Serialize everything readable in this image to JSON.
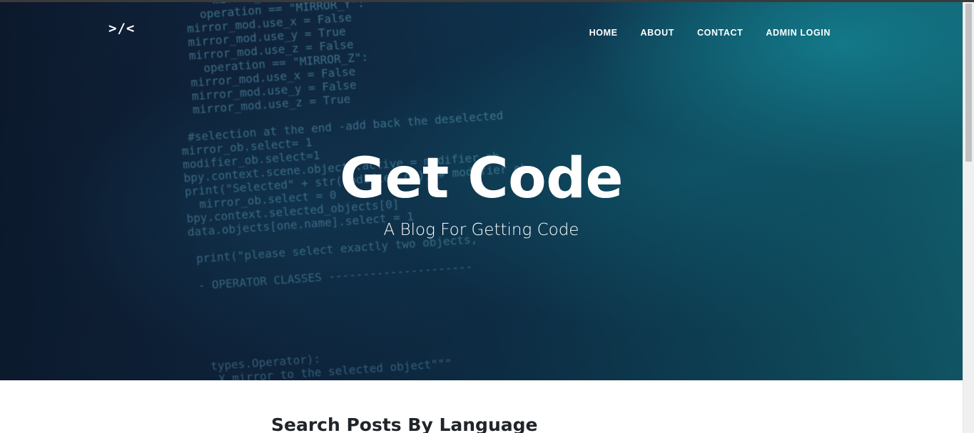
{
  "brand": {
    "logo_text": ">/<"
  },
  "nav": {
    "items": [
      {
        "label": "HOME"
      },
      {
        "label": "ABOUT"
      },
      {
        "label": "CONTACT"
      },
      {
        "label": "ADMIN LOGIN"
      }
    ]
  },
  "hero": {
    "title": "Get Code",
    "subtitle": "A Blog For Getting Code",
    "code_lines": [
      "       mirror_mod.use_z = False",
      "     operation == \"MIRROR_Y\":",
      "   mirror_mod.use_x = False",
      "   mirror_mod.use_y = True",
      "   mirror_mod.use_z = False",
      "     operation == \"MIRROR_Z\":",
      "   mirror_mod.use_x = False",
      "   mirror_mod.use_y = False",
      "   mirror_mod.use_z = True",
      "",
      "  #selection at the end -add back the deselected",
      " mirror_ob.select= 1",
      " modifier_ob.select=1",
      " bpy.context.scene.objects.active = modifier_ob",
      " print(\"Selected\" + str(modifier_ob)) # modifier ob",
      "   mirror_ob.select = 0",
      " bpy.context.selected_objects[0]",
      " data.objects[one.name].select = 1",
      "",
      "  print(\"please select exactly two objects,",
      "",
      "  - OPERATOR CLASSES ---------------------",
      "",
      "",
      "",
      "",
      "",
      "   types.Operator):",
      "    X mirror to the selected object\"\"\""
    ]
  },
  "main": {
    "section_heading": "Search Posts By Language"
  }
}
